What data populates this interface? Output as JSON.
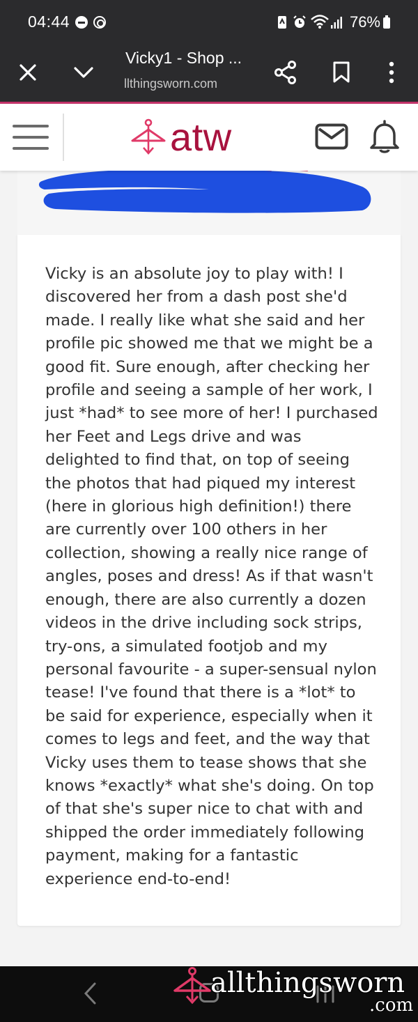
{
  "status_bar": {
    "time": "04:44",
    "battery": "76%"
  },
  "browser": {
    "tab_title": "Vicky1 - Shop ...",
    "url": "llthingsworn.com"
  },
  "site": {
    "logo_text": "atw",
    "brand_color": "#a8123e",
    "accent_color": "#e03a68"
  },
  "review": {
    "text": "Vicky is an absolute joy to play with! I discovered her from a dash post she'd made. I really like what she said and her profile pic showed me that we might be a good fit. Sure enough, after checking her profile and seeing a sample of her work, I just *had* to see more of her! I purchased her Feet and Legs drive and was delighted to find that, on top of seeing the photos that had piqued my interest (here in glorious high definition!) there are currently over 100 others in her collection, showing a really nice range of angles, poses and dress! As if that wasn't enough, there are also currently a dozen videos in the drive including sock strips, try-ons, a simulated footjob and my personal favourite - a super-sensual nylon tease! I've found that there is a *lot* to be said for experience, especially when it comes to legs and feet, and the way that Vicky uses them to tease shows that she knows *exactly* what she's doing. On top of that she's super nice to chat with and shipped the order immediately following payment, making for a fantastic experience end-to-end!",
    "redaction_color": "#1e4fe0"
  },
  "watermark": {
    "text": "allthingsworn",
    "suffix": ".com"
  },
  "icons": [
    "close-icon",
    "chevron-down-icon",
    "share-icon",
    "bookmark-icon",
    "more-vert-icon",
    "menu-icon",
    "mail-icon",
    "bell-icon",
    "back-icon",
    "home-icon",
    "recent-apps-icon"
  ]
}
